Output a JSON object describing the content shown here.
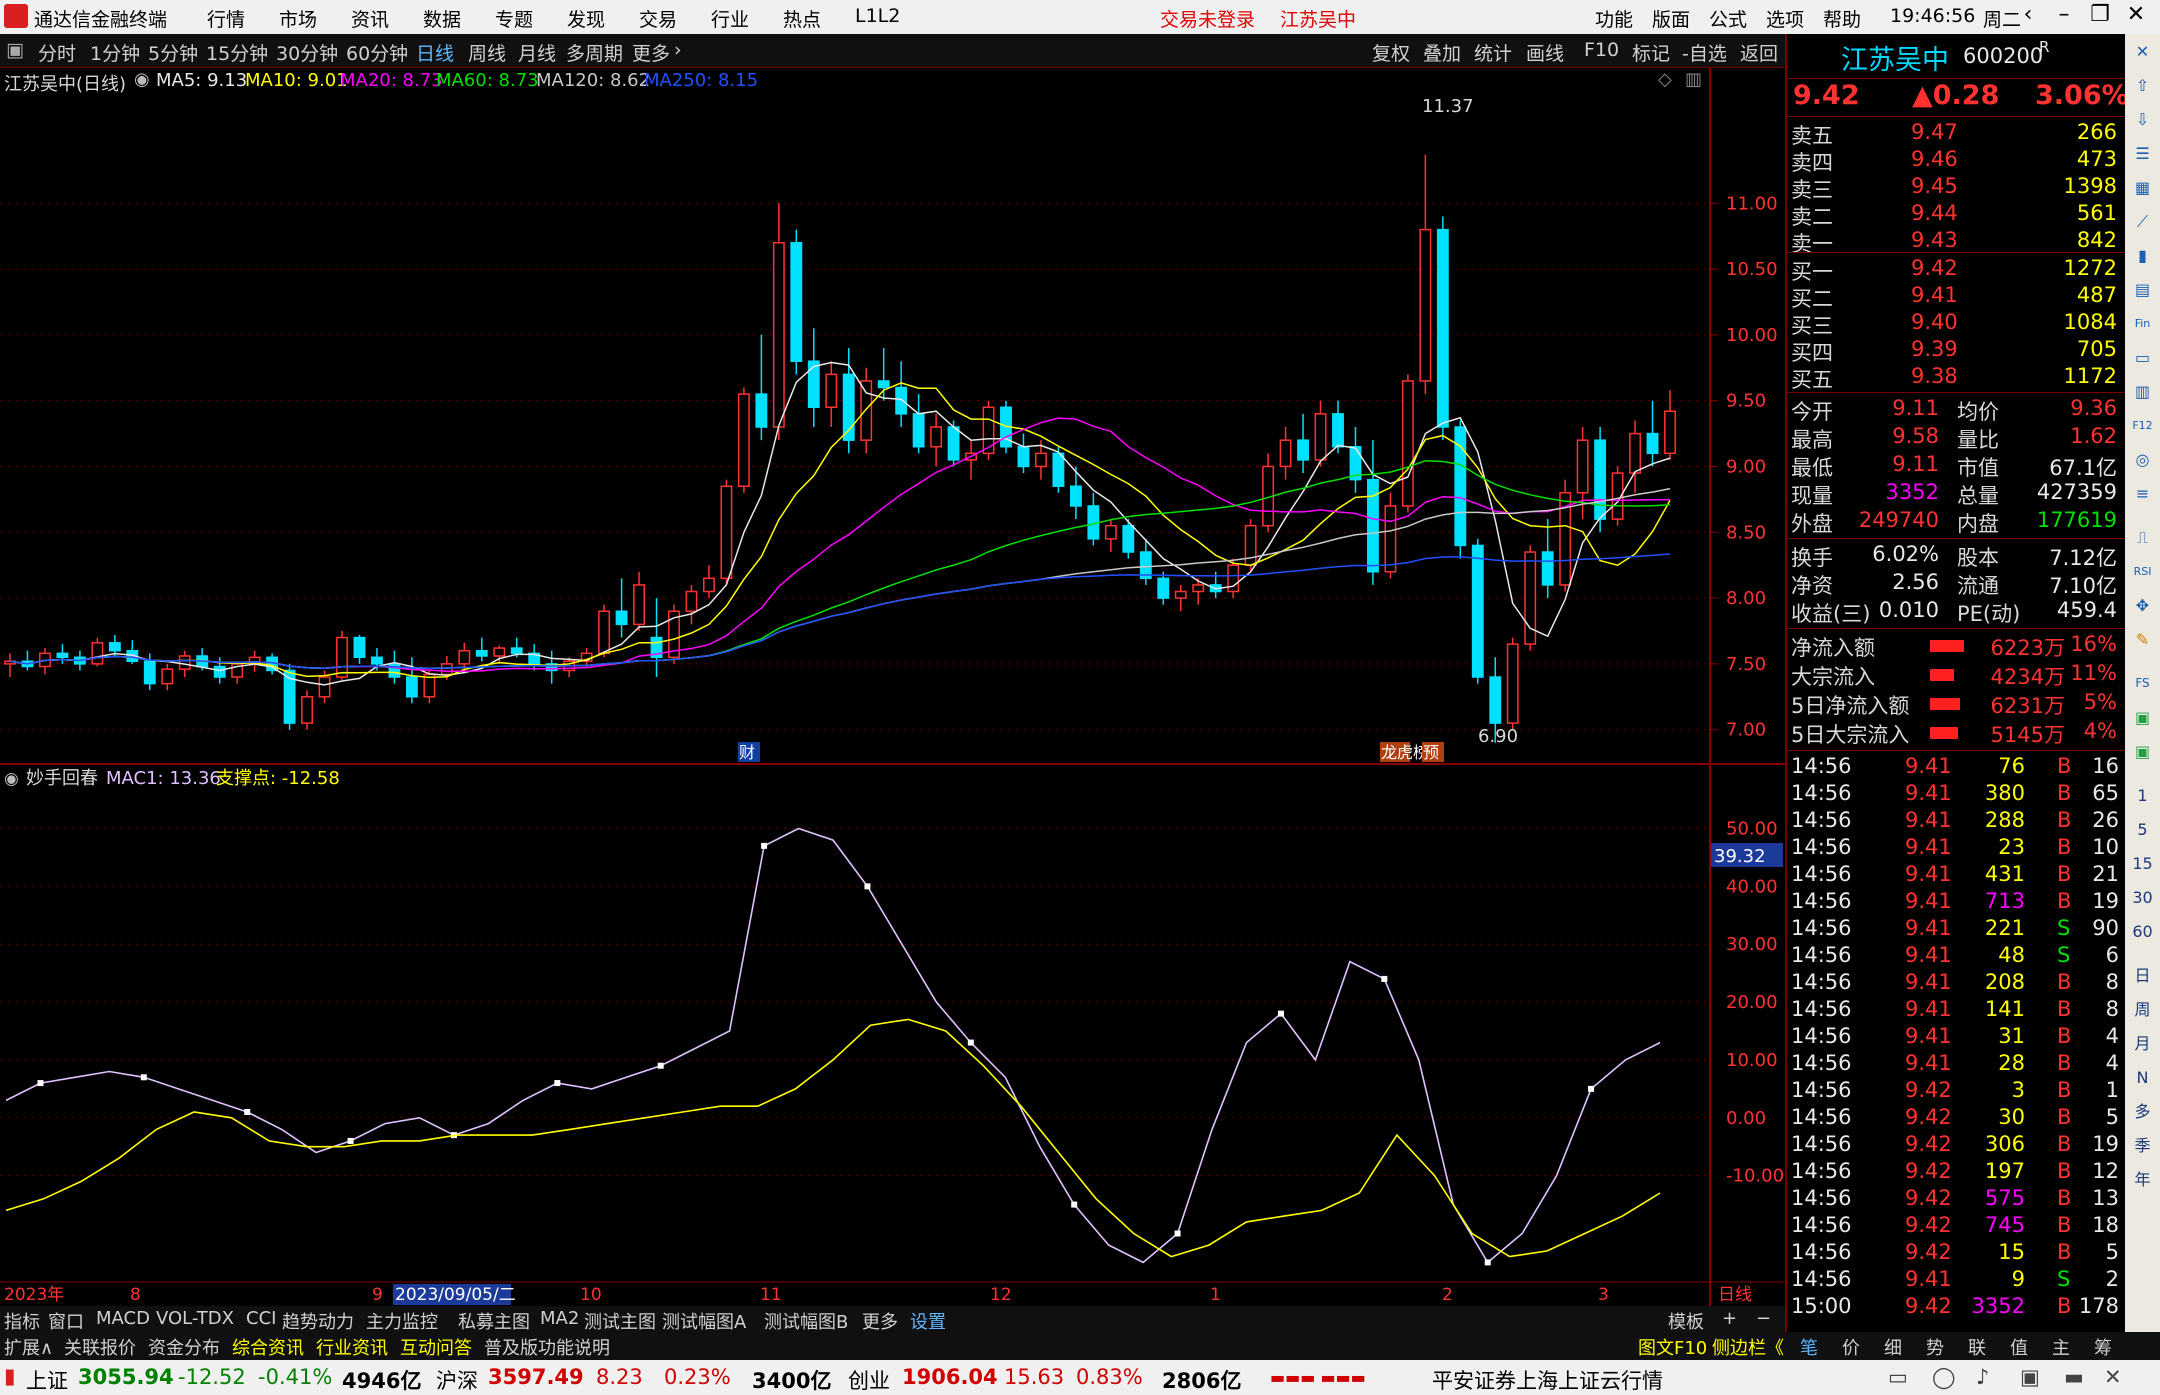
{
  "titlebar": {
    "app_title": "通达信金融终端",
    "menus": [
      "行情",
      "市场",
      "资讯",
      "数据",
      "专题",
      "发现",
      "交易",
      "行业",
      "热点",
      "L1L2"
    ],
    "alerts": [
      "交易未登录",
      "江苏吴中"
    ],
    "right_menus": [
      "功能",
      "版面",
      "公式",
      "选项",
      "帮助"
    ],
    "time": "19:46:56",
    "weekday": "周二"
  },
  "toolbar": {
    "timeframes": [
      "分时",
      "1分钟",
      "5分钟",
      "15分钟",
      "30分钟",
      "60分钟",
      "日线",
      "周线",
      "月线",
      "多周期",
      "更多"
    ],
    "active": "日线",
    "tools": [
      "复权",
      "叠加",
      "统计",
      "画线",
      "F10",
      "标记",
      "-自选",
      "返回"
    ]
  },
  "main_chart": {
    "stock_label": "江苏吴中(日线)",
    "ma": [
      {
        "label": "MA5: 9.13",
        "color": "#e8e8e8"
      },
      {
        "label": "MA10: 9.01",
        "color": "#ffff00"
      },
      {
        "label": "MA20: 8.73",
        "color": "#ff00ff"
      },
      {
        "label": "MA60: 8.73",
        "color": "#00e000"
      },
      {
        "label": "MA120: 8.62",
        "color": "#c8c8c8"
      },
      {
        "label": "MA250: 8.15",
        "color": "#2050ff"
      }
    ],
    "high_label": "11.37",
    "low_label": "6.90",
    "markers": [
      "财",
      "龙虎榜",
      "预"
    ]
  },
  "indicator": {
    "name": "妙手回春",
    "mac1_label": "MAC1: 13.36",
    "support_label": "支撑点: -12.58",
    "current_value": "39.32"
  },
  "chart_data": [
    {
      "type": "candlestick",
      "title": "江苏吴中(日线)",
      "ylim": [
        6.8,
        11.8
      ],
      "yticks": [
        "11.00",
        "10.50",
        "10.00",
        "9.50",
        "9.00",
        "8.50",
        "8.00",
        "7.50",
        "7.00"
      ],
      "xticks": [
        "2023年",
        "8",
        "9",
        "2023/09/05/二",
        "10",
        "11",
        "12",
        "1",
        "2",
        "3",
        "日线"
      ],
      "ohlc": [
        [
          7.5,
          7.58,
          7.4,
          7.52
        ],
        [
          7.52,
          7.6,
          7.45,
          7.48
        ],
        [
          7.48,
          7.62,
          7.42,
          7.58
        ],
        [
          7.58,
          7.65,
          7.5,
          7.55
        ],
        [
          7.55,
          7.6,
          7.45,
          7.5
        ],
        [
          7.5,
          7.7,
          7.48,
          7.66
        ],
        [
          7.66,
          7.72,
          7.55,
          7.6
        ],
        [
          7.6,
          7.68,
          7.5,
          7.52
        ],
        [
          7.52,
          7.58,
          7.3,
          7.35
        ],
        [
          7.35,
          7.5,
          7.3,
          7.46
        ],
        [
          7.46,
          7.6,
          7.4,
          7.56
        ],
        [
          7.56,
          7.62,
          7.45,
          7.48
        ],
        [
          7.48,
          7.55,
          7.35,
          7.4
        ],
        [
          7.4,
          7.52,
          7.35,
          7.5
        ],
        [
          7.5,
          7.6,
          7.44,
          7.55
        ],
        [
          7.55,
          7.58,
          7.42,
          7.45
        ],
        [
          7.45,
          7.5,
          7.0,
          7.05
        ],
        [
          7.05,
          7.3,
          7.0,
          7.25
        ],
        [
          7.25,
          7.45,
          7.2,
          7.4
        ],
        [
          7.4,
          7.75,
          7.38,
          7.7
        ],
        [
          7.7,
          7.72,
          7.5,
          7.55
        ],
        [
          7.55,
          7.62,
          7.45,
          7.5
        ],
        [
          7.5,
          7.6,
          7.35,
          7.4
        ],
        [
          7.4,
          7.55,
          7.2,
          7.25
        ],
        [
          7.25,
          7.45,
          7.2,
          7.42
        ],
        [
          7.42,
          7.56,
          7.38,
          7.5
        ],
        [
          7.5,
          7.66,
          7.45,
          7.6
        ],
        [
          7.6,
          7.7,
          7.52,
          7.56
        ],
        [
          7.56,
          7.64,
          7.5,
          7.62
        ],
        [
          7.62,
          7.7,
          7.55,
          7.58
        ],
        [
          7.58,
          7.65,
          7.45,
          7.5
        ],
        [
          7.5,
          7.6,
          7.35,
          7.45
        ],
        [
          7.45,
          7.55,
          7.4,
          7.52
        ],
        [
          7.52,
          7.62,
          7.48,
          7.58
        ],
        [
          7.58,
          7.95,
          7.55,
          7.9
        ],
        [
          7.9,
          8.15,
          7.7,
          7.8
        ],
        [
          7.8,
          8.2,
          7.75,
          8.1
        ],
        [
          7.7,
          8.0,
          7.4,
          7.55
        ],
        [
          7.55,
          7.95,
          7.5,
          7.9
        ],
        [
          7.9,
          8.1,
          7.8,
          8.05
        ],
        [
          8.05,
          8.25,
          8.0,
          8.15
        ],
        [
          8.15,
          8.9,
          8.1,
          8.85
        ],
        [
          8.85,
          9.6,
          8.8,
          9.55
        ],
        [
          9.55,
          10.0,
          9.2,
          9.3
        ],
        [
          9.3,
          11.0,
          9.2,
          10.7
        ],
        [
          10.7,
          10.8,
          9.7,
          9.8
        ],
        [
          9.8,
          10.05,
          9.3,
          9.45
        ],
        [
          9.45,
          9.8,
          9.3,
          9.7
        ],
        [
          9.7,
          9.9,
          9.1,
          9.2
        ],
        [
          9.2,
          9.75,
          9.1,
          9.65
        ],
        [
          9.65,
          9.9,
          9.5,
          9.6
        ],
        [
          9.6,
          9.8,
          9.3,
          9.4
        ],
        [
          9.4,
          9.55,
          9.1,
          9.15
        ],
        [
          9.15,
          9.4,
          9.0,
          9.3
        ],
        [
          9.3,
          9.35,
          9.0,
          9.05
        ],
        [
          9.05,
          9.2,
          8.9,
          9.1
        ],
        [
          9.1,
          9.5,
          9.05,
          9.45
        ],
        [
          9.45,
          9.5,
          9.1,
          9.15
        ],
        [
          9.15,
          9.25,
          8.95,
          9.0
        ],
        [
          9.0,
          9.2,
          8.9,
          9.1
        ],
        [
          9.1,
          9.15,
          8.8,
          8.85
        ],
        [
          8.85,
          9.0,
          8.6,
          8.7
        ],
        [
          8.7,
          8.8,
          8.4,
          8.45
        ],
        [
          8.45,
          8.6,
          8.35,
          8.55
        ],
        [
          8.55,
          8.6,
          8.3,
          8.35
        ],
        [
          8.35,
          8.45,
          8.1,
          8.15
        ],
        [
          8.15,
          8.2,
          7.95,
          8.0
        ],
        [
          8.0,
          8.1,
          7.9,
          8.05
        ],
        [
          8.05,
          8.15,
          7.95,
          8.1
        ],
        [
          8.1,
          8.2,
          8.0,
          8.05
        ],
        [
          8.05,
          8.3,
          8.0,
          8.25
        ],
        [
          8.25,
          8.6,
          8.2,
          8.55
        ],
        [
          8.55,
          9.1,
          8.5,
          9.0
        ],
        [
          9.0,
          9.3,
          8.9,
          9.2
        ],
        [
          9.2,
          9.4,
          8.95,
          9.05
        ],
        [
          9.05,
          9.5,
          9.0,
          9.4
        ],
        [
          9.4,
          9.5,
          9.1,
          9.15
        ],
        [
          9.15,
          9.3,
          8.8,
          8.9
        ],
        [
          8.9,
          9.2,
          8.1,
          8.2
        ],
        [
          8.2,
          8.8,
          8.15,
          8.7
        ],
        [
          8.7,
          9.7,
          8.65,
          9.65
        ],
        [
          9.65,
          11.37,
          9.55,
          10.8
        ],
        [
          10.8,
          10.9,
          9.2,
          9.3
        ],
        [
          9.3,
          9.35,
          8.3,
          8.4
        ],
        [
          8.4,
          8.45,
          7.35,
          7.4
        ],
        [
          7.4,
          7.55,
          6.9,
          7.05
        ],
        [
          7.05,
          7.7,
          7.0,
          7.65
        ],
        [
          7.65,
          8.4,
          7.6,
          8.35
        ],
        [
          8.35,
          8.6,
          8.0,
          8.1
        ],
        [
          8.1,
          8.9,
          8.05,
          8.8
        ],
        [
          8.8,
          9.3,
          8.6,
          9.2
        ],
        [
          9.2,
          9.3,
          8.5,
          8.6
        ],
        [
          8.6,
          9.0,
          8.55,
          8.95
        ],
        [
          8.95,
          9.35,
          8.8,
          9.25
        ],
        [
          9.25,
          9.5,
          9.0,
          9.1
        ],
        [
          9.1,
          9.58,
          9.05,
          9.42
        ]
      ]
    },
    {
      "type": "line",
      "title": "妙手回春",
      "ylim": [
        -27,
        57
      ],
      "yticks": [
        "50.00",
        "40.00",
        "30.00",
        "20.00",
        "10.00",
        "0.00",
        "-10.00"
      ],
      "series": [
        {
          "name": "MAC1",
          "color": "#e0c0ff",
          "values": [
            3,
            6,
            7,
            8,
            7,
            5,
            3,
            1,
            -2,
            -6,
            -4,
            -1,
            0,
            -3,
            -1,
            3,
            6,
            5,
            7,
            9,
            12,
            15,
            47,
            50,
            48,
            40,
            30,
            20,
            13,
            7,
            -5,
            -15,
            -22,
            -25,
            -20,
            -2,
            13,
            18,
            10,
            27,
            24,
            10,
            -15,
            -25,
            -20,
            -10,
            5,
            10,
            13
          ]
        },
        {
          "name": "支撑点",
          "color": "#ffff00",
          "values": [
            -16,
            -14,
            -11,
            -7,
            -2,
            1,
            0,
            -4,
            -5,
            -5,
            -4,
            -4,
            -3,
            -3,
            -3,
            -2,
            -1,
            0,
            1,
            2,
            2,
            5,
            10,
            16,
            17,
            15,
            9,
            2,
            -6,
            -14,
            -20,
            -24,
            -22,
            -18,
            -17,
            -16,
            -13,
            -3,
            -10,
            -20,
            -24,
            -23,
            -20,
            -17,
            -13
          ]
        }
      ]
    }
  ],
  "quote": {
    "name": "江苏吴中",
    "code": "600200",
    "badge": "R",
    "price": "9.42",
    "change": "▲0.28",
    "pct": "3.06%",
    "asks": [
      {
        "label": "卖五",
        "price": "9.47",
        "vol": "266"
      },
      {
        "label": "卖四",
        "price": "9.46",
        "vol": "473"
      },
      {
        "label": "卖三",
        "price": "9.45",
        "vol": "1398"
      },
      {
        "label": "卖二",
        "price": "9.44",
        "vol": "561"
      },
      {
        "label": "卖一",
        "price": "9.43",
        "vol": "842"
      }
    ],
    "bids": [
      {
        "label": "买一",
        "price": "9.42",
        "vol": "1272"
      },
      {
        "label": "买二",
        "price": "9.41",
        "vol": "487"
      },
      {
        "label": "买三",
        "price": "9.40",
        "vol": "1084"
      },
      {
        "label": "买四",
        "price": "9.39",
        "vol": "705"
      },
      {
        "label": "买五",
        "price": "9.38",
        "vol": "1172"
      }
    ],
    "stats": [
      {
        "l1": "今开",
        "v1": "9.11",
        "l2": "均价",
        "v2": "9.36",
        "c1": "#ff3232",
        "c2": "#ff3232"
      },
      {
        "l1": "最高",
        "v1": "9.58",
        "l2": "量比",
        "v2": "1.62",
        "c1": "#ff3232",
        "c2": "#ff3232"
      },
      {
        "l1": "最低",
        "v1": "9.11",
        "l2": "市值",
        "v2": "67.1亿",
        "c1": "#ff3232",
        "c2": "#e8e8e8"
      },
      {
        "l1": "现量",
        "v1": "3352",
        "l2": "总量",
        "v2": "427359",
        "c1": "#ff00ff",
        "c2": "#e8e8e8"
      },
      {
        "l1": "外盘",
        "v1": "249740",
        "l2": "内盘",
        "v2": "177619",
        "c1": "#ff3232",
        "c2": "#00e000"
      }
    ],
    "stats2": [
      {
        "l1": "换手",
        "v1": "6.02%",
        "l2": "股本",
        "v2": "7.12亿"
      },
      {
        "l1": "净资",
        "v1": "2.56",
        "l2": "流通",
        "v2": "7.10亿"
      },
      {
        "l1": "收益(三)",
        "v1": "0.010",
        "l2": "PE(动)",
        "v2": "459.4"
      }
    ],
    "flows": [
      {
        "label": "净流入额",
        "value": "6223万",
        "pct": "16%"
      },
      {
        "label": "大宗流入",
        "value": "4234万",
        "pct": "11%"
      },
      {
        "label": "5日净流入额",
        "value": "6231万",
        "pct": "5%"
      },
      {
        "label": "5日大宗流入",
        "value": "5145万",
        "pct": "4%"
      }
    ]
  },
  "ticks": [
    [
      "14:56",
      "9.41",
      "76",
      "B",
      "16"
    ],
    [
      "14:56",
      "9.41",
      "380",
      "B",
      "65"
    ],
    [
      "14:56",
      "9.41",
      "288",
      "B",
      "26"
    ],
    [
      "14:56",
      "9.41",
      "23",
      "B",
      "10"
    ],
    [
      "14:56",
      "9.41",
      "431",
      "B",
      "21"
    ],
    [
      "14:56",
      "9.41",
      "713",
      "B",
      "19"
    ],
    [
      "14:56",
      "9.41",
      "221",
      "S",
      "90"
    ],
    [
      "14:56",
      "9.41",
      "48",
      "S",
      "6"
    ],
    [
      "14:56",
      "9.41",
      "208",
      "B",
      "8"
    ],
    [
      "14:56",
      "9.41",
      "141",
      "B",
      "8"
    ],
    [
      "14:56",
      "9.41",
      "31",
      "B",
      "4"
    ],
    [
      "14:56",
      "9.41",
      "28",
      "B",
      "4"
    ],
    [
      "14:56",
      "9.42",
      "3",
      "B",
      "1"
    ],
    [
      "14:56",
      "9.42",
      "30",
      "B",
      "5"
    ],
    [
      "14:56",
      "9.42",
      "306",
      "B",
      "19"
    ],
    [
      "14:56",
      "9.42",
      "197",
      "B",
      "12"
    ],
    [
      "14:56",
      "9.42",
      "575",
      "B",
      "13"
    ],
    [
      "14:56",
      "9.42",
      "745",
      "B",
      "18"
    ],
    [
      "14:56",
      "9.42",
      "15",
      "B",
      "5"
    ],
    [
      "14:56",
      "9.41",
      "9",
      "S",
      "2"
    ],
    [
      "15:00",
      "9.42",
      "3352",
      "B",
      "178"
    ]
  ],
  "tabs1": [
    "指标",
    "窗口",
    "MACD",
    "VOL-TDX",
    "CCI",
    "趋势动力",
    "主力监控",
    "私募主图",
    "MA2",
    "测试主图",
    "测试幅图A",
    "测试幅图B",
    "更多",
    "设置"
  ],
  "tabs1_right": [
    "模板",
    "+",
    "−"
  ],
  "tabs2": [
    "扩展∧",
    "关联报价",
    "资金分布",
    "综合资讯",
    "行业资讯",
    "互动问答",
    "普及版功能说明"
  ],
  "tabs2_right": [
    "图文F10",
    "侧边栏《"
  ],
  "side_tabs": [
    "笔",
    "价",
    "细",
    "势",
    "联",
    "值",
    "主",
    "筹"
  ],
  "iconstrip_right": [
    "日",
    "周",
    "月",
    "N",
    "多",
    "季",
    "年"
  ],
  "iconstrip_top": [
    "1",
    "5",
    "15",
    "30",
    "60"
  ],
  "status": {
    "sh_label": "上证",
    "sh": "3055.94",
    "sh_chg": "-12.52",
    "sh_pct": "-0.41%",
    "sh_amt": "4946亿",
    "sz_label": "沪深",
    "sz": "3597.49",
    "sz_chg": "8.23",
    "sz_pct": "0.23%",
    "sz_amt": "3400亿",
    "cy_label": "创业",
    "cy": "1906.04",
    "cy_chg": "15.63",
    "cy_pct": "0.83%",
    "cy_amt": "2806亿",
    "broker": "平安证券上海上证云行情"
  }
}
